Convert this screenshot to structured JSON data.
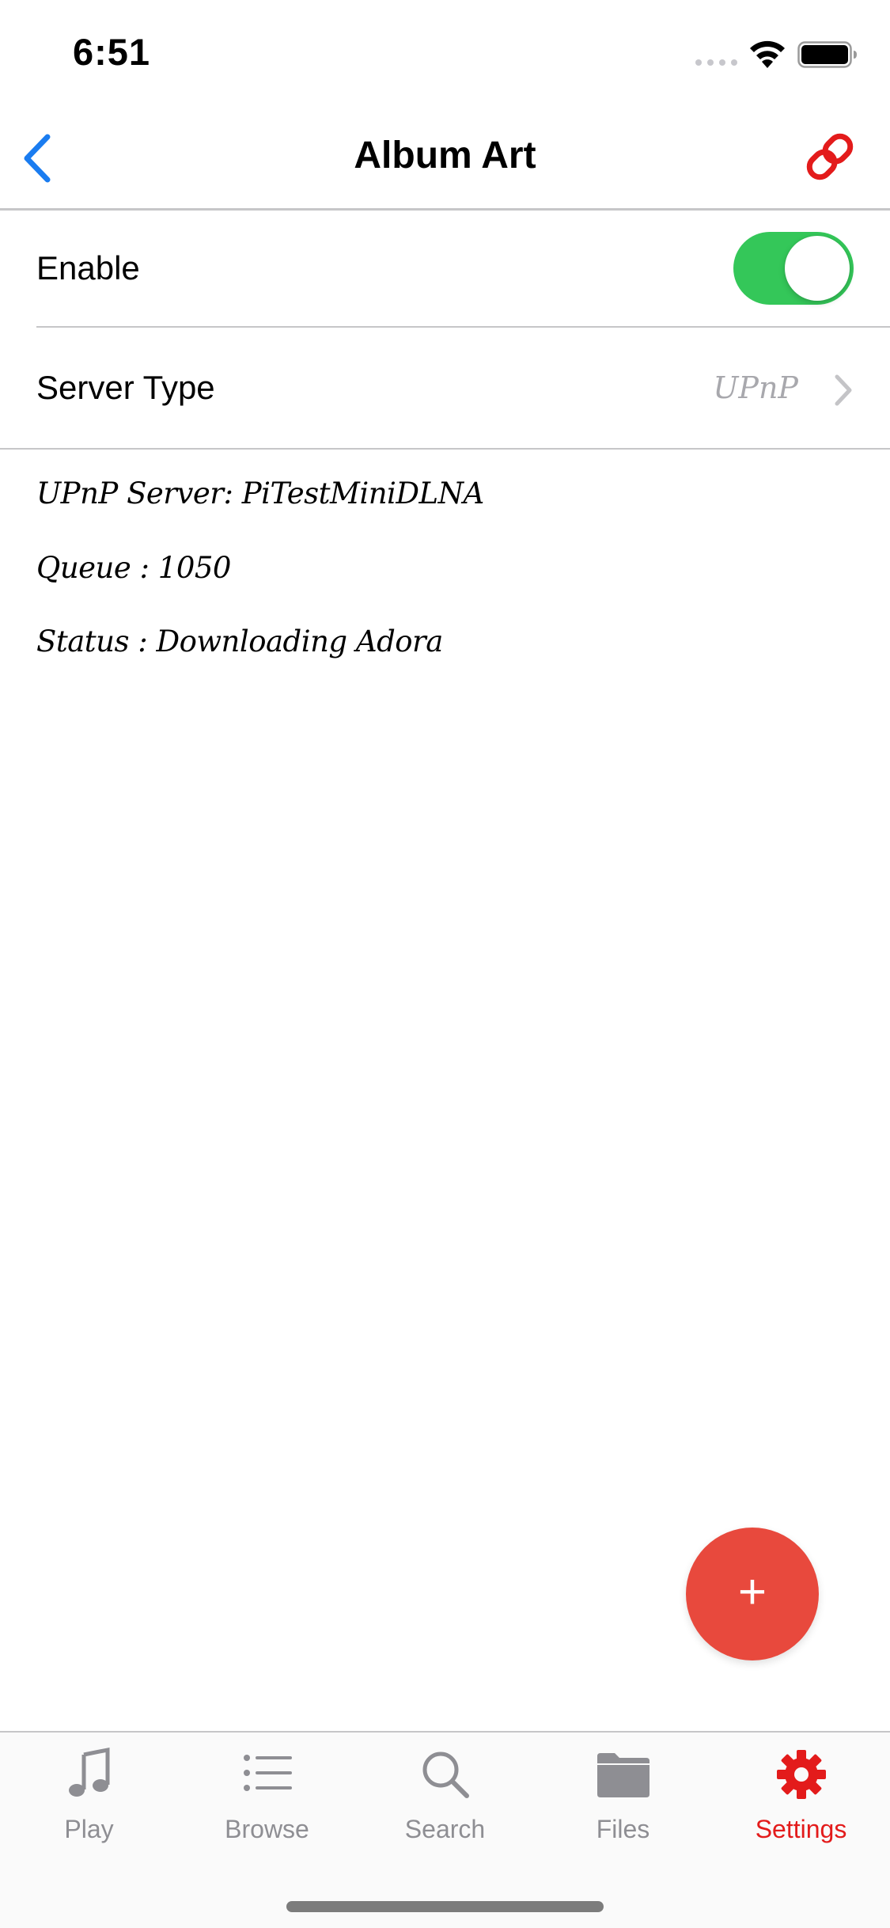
{
  "status_bar": {
    "time": "6:51"
  },
  "nav": {
    "title": "Album Art",
    "back_icon": "chevron-left-icon",
    "action_icon": "link-icon"
  },
  "settings": {
    "enable_label": "Enable",
    "enable_on": true,
    "server_type_label": "Server Type",
    "server_type_value": "UPnP"
  },
  "info": {
    "server_line": "UPnP Server: PiTestMiniDLNA",
    "queue_line": "Queue : 1050",
    "status_line": "Status : Downloading Adora"
  },
  "fab": {
    "label": "+"
  },
  "tabs": [
    {
      "label": "Play",
      "icon": "music-note-icon",
      "active": false
    },
    {
      "label": "Browse",
      "icon": "list-icon",
      "active": false
    },
    {
      "label": "Search",
      "icon": "search-icon",
      "active": false
    },
    {
      "label": "Files",
      "icon": "folder-icon",
      "active": false
    },
    {
      "label": "Settings",
      "icon": "gear-icon",
      "active": true
    }
  ],
  "colors": {
    "accent_blue": "#1a7cf0",
    "accent_red": "#e31b1b",
    "toggle_green": "#34c759",
    "fab_red": "#e8493d",
    "inactive_gray": "#8e8e93"
  }
}
